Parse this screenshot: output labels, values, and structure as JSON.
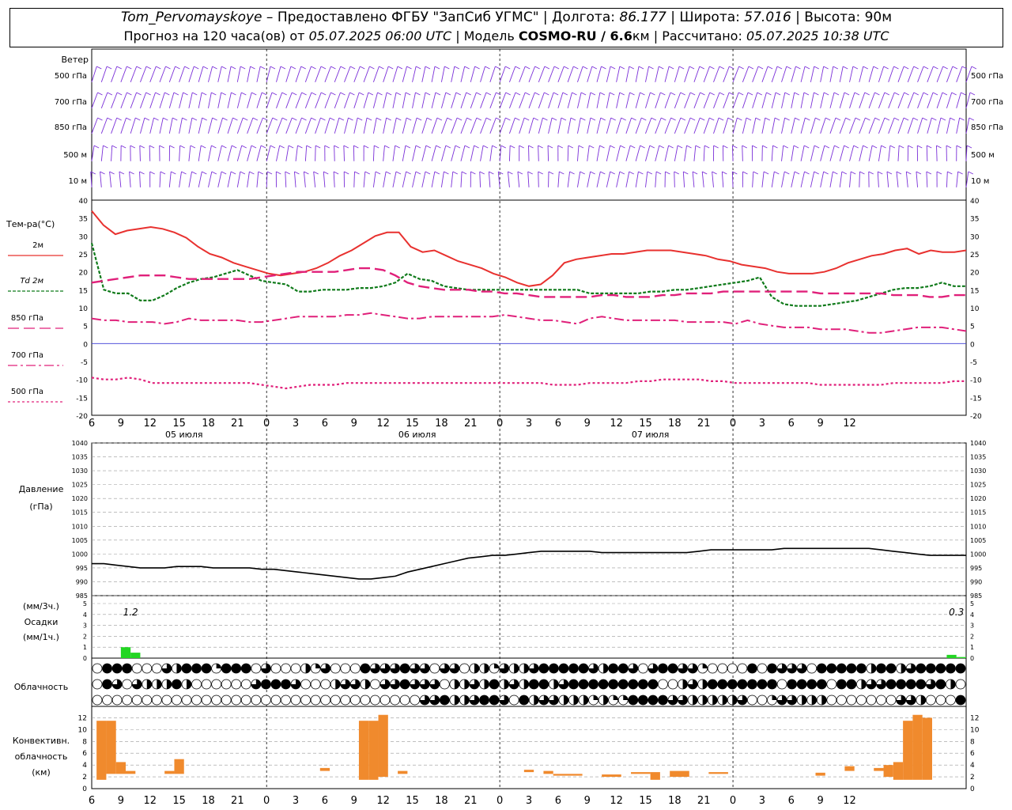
{
  "header": {
    "station": "Tom_Pervomayskoye",
    "provider": " – Предоставлено ФГБУ \"ЗапСиб УГМС\" | Долгота: ",
    "lon": "86.177",
    "lat_label": " | Широта: ",
    "lat": "57.016",
    "alt_label": " | Высота: ",
    "alt": "90м",
    "forecast_label": "Прогноз на 120 часа(ов) от ",
    "run_time": "05.07.2025 06:00 UTC",
    "model_label": " | Модель ",
    "model": "COSMO-RU / 6.6",
    "model_unit": "км | Рассчитано: ",
    "calc_time": "05.07.2025 10:38 UTC"
  },
  "labels": {
    "wind": "Ветер",
    "levels": [
      "500 гПа",
      "700 гПа",
      "850 гПа",
      "500 м",
      "10 м"
    ],
    "temp": "Тем-ра(°С)",
    "legend": [
      "2м",
      "Td 2м",
      "850 гПа",
      "700 гПа",
      "500 гПа"
    ],
    "pressure": [
      "Давление",
      "(гПа)"
    ],
    "precip": [
      "(мм/3ч.)",
      "Осадки",
      "(мм/1ч.)"
    ],
    "cloud": "Облачность",
    "conv": [
      "Конвективн.",
      "облачность",
      "(км)"
    ],
    "days": [
      "05 июля",
      "06 июля",
      "07 июля"
    ],
    "precip_vals": [
      "1.2",
      "0.3"
    ]
  },
  "colors": {
    "t2m": "#e8312f",
    "td": "#0f7a1a",
    "t850": "#e0207a",
    "t700": "#e0207a",
    "t500": "#e0207a",
    "wind": "#7a2fd8",
    "zero": "#3b3bd6",
    "pres": "#000000",
    "precip": "#22d622",
    "conv": "#f08a2d"
  },
  "chart_data": [
    {
      "type": "line",
      "title": "Тем-ра(°С)",
      "x_hours": [
        6,
        7,
        8,
        9,
        10,
        11,
        12,
        13,
        14,
        15,
        16,
        17,
        18,
        19,
        20,
        21,
        22,
        23,
        24,
        25,
        26,
        27,
        28,
        29,
        30,
        31,
        32,
        33,
        34,
        35,
        36,
        37,
        38,
        39,
        40,
        41,
        42,
        43,
        44,
        45,
        46,
        47,
        48,
        49,
        50,
        51,
        52,
        53,
        54,
        55,
        56,
        57,
        58,
        59,
        60,
        61,
        62,
        63,
        64,
        65,
        66,
        67,
        68,
        69,
        70,
        71,
        72,
        73,
        74,
        75,
        76,
        77,
        78,
        79,
        80,
        81,
        82,
        83,
        84,
        85,
        86,
        87,
        88,
        89,
        90,
        91,
        92,
        93,
        94,
        95,
        96
      ],
      "ylim": [
        -20,
        40
      ],
      "xtick_labels": [
        "6",
        "9",
        "12",
        "15",
        "18",
        "21",
        "0",
        "3",
        "6",
        "9",
        "12",
        "15",
        "18",
        "21",
        "0",
        "3",
        "6",
        "9",
        "12",
        "15",
        "18",
        "21",
        "0",
        "3",
        "6",
        "9",
        "12"
      ],
      "series": [
        {
          "name": "2м",
          "values": [
            37,
            33,
            30.5,
            31.5,
            32,
            32.5,
            32,
            31,
            29.5,
            27,
            25,
            24,
            22.5,
            21.5,
            20.5,
            19.5,
            19,
            19.5,
            20,
            21,
            22.5,
            24.5,
            26,
            28,
            30,
            31,
            31,
            27,
            25.5,
            26,
            24.5,
            23,
            22,
            21,
            19.5,
            18.5,
            17,
            16,
            16.5,
            19,
            22.5,
            23.5,
            24,
            24.5,
            25,
            25,
            25.5,
            26,
            26,
            26,
            25.5,
            25,
            24.5,
            23.5,
            23,
            22,
            21.5,
            21,
            20,
            19.5,
            19.5,
            19.5,
            20,
            21,
            22.5,
            23.5,
            24.5,
            25,
            26,
            26.5,
            25,
            26,
            25.5,
            25.5,
            26
          ]
        },
        {
          "name": "Td 2м",
          "values": [
            28,
            15,
            14,
            14,
            12,
            12,
            13.5,
            15.5,
            17,
            18,
            18.5,
            19.5,
            20.5,
            19,
            17.5,
            17,
            16.5,
            14.5,
            14.5,
            15,
            15,
            15,
            15.5,
            15.5,
            16,
            17,
            19.5,
            18,
            17.5,
            16,
            15.5,
            15,
            15,
            15,
            15,
            15,
            15,
            15,
            15,
            15,
            15,
            14,
            14,
            14,
            14,
            14,
            14.5,
            14.5,
            15,
            15,
            15.5,
            16,
            16.5,
            17,
            17.5,
            18.5,
            13,
            11,
            10.5,
            10.5,
            10.5,
            11,
            11.5,
            12,
            13,
            14,
            15,
            15.5,
            15.5,
            16,
            17,
            16,
            16
          ]
        },
        {
          "name": "850 гПа",
          "values": [
            17,
            17.5,
            18,
            18.5,
            19,
            19,
            19,
            18.5,
            18,
            18,
            18,
            18,
            18,
            18,
            18.5,
            19,
            19.5,
            20,
            20,
            20,
            20,
            20.5,
            21,
            21,
            20.5,
            19,
            17,
            16,
            15.5,
            15,
            15,
            15,
            14.5,
            14.5,
            14,
            14,
            13.5,
            13,
            13,
            13,
            13,
            13,
            13.5,
            13.5,
            13,
            13,
            13,
            13.5,
            13.5,
            14,
            14,
            14,
            14.5,
            14.5,
            14.5,
            14.5,
            14.5,
            14.5,
            14.5,
            14.5,
            14,
            14,
            14,
            14,
            14,
            14,
            13.5,
            13.5,
            13.5,
            13,
            13,
            13.5,
            13.5
          ]
        },
        {
          "name": "700 гПа",
          "values": [
            7,
            6.5,
            6.5,
            6,
            6,
            6,
            5.5,
            6,
            7,
            6.5,
            6.5,
            6.5,
            6.5,
            6,
            6,
            6.5,
            7,
            7.5,
            7.5,
            7.5,
            7.5,
            8,
            8,
            8.5,
            8,
            7.5,
            7,
            7,
            7.5,
            7.5,
            7.5,
            7.5,
            7.5,
            7.5,
            8,
            7.5,
            7,
            6.5,
            6.5,
            6,
            5.5,
            7,
            7.5,
            7,
            6.5,
            6.5,
            6.5,
            6.5,
            6.5,
            6,
            6,
            6,
            6,
            5.5,
            6.5,
            5.5,
            5,
            4.5,
            4.5,
            4.5,
            4,
            4,
            4,
            3.5,
            3,
            3,
            3.5,
            4,
            4.5,
            4.5,
            4.5,
            4,
            3.5
          ]
        },
        {
          "name": "500 гПа",
          "values": [
            -9.5,
            -10,
            -10,
            -9.5,
            -10,
            -11,
            -11,
            -11,
            -11,
            -11,
            -11,
            -11,
            -11,
            -11,
            -11.5,
            -12,
            -12.5,
            -12,
            -11.5,
            -11.5,
            -11.5,
            -11,
            -11,
            -11,
            -11,
            -11,
            -11,
            -11,
            -11,
            -11,
            -11,
            -11,
            -11,
            -11,
            -11,
            -11,
            -11,
            -11,
            -11.5,
            -11.5,
            -11.5,
            -11,
            -11,
            -11,
            -11,
            -10.5,
            -10.5,
            -10,
            -10,
            -10,
            -10,
            -10.5,
            -10.5,
            -11,
            -11,
            -11,
            -11,
            -11,
            -11,
            -11,
            -11.5,
            -11.5,
            -11.5,
            -11.5,
            -11.5,
            -11.5,
            -11,
            -11,
            -11,
            -11,
            -11,
            -10.5,
            -10.5
          ]
        }
      ]
    },
    {
      "type": "line",
      "title": "Давление (гПа)",
      "ylim": [
        985,
        1040
      ],
      "series": [
        {
          "name": "Давление",
          "values": [
            996.5,
            996.5,
            996,
            995.5,
            995,
            995,
            995,
            995.5,
            995.5,
            995.5,
            995,
            995,
            995,
            995,
            994.5,
            994.5,
            994,
            993.5,
            993,
            992.5,
            992,
            991.5,
            991,
            991,
            991.5,
            992,
            993.5,
            994.5,
            995.5,
            996.5,
            997.5,
            998.5,
            999,
            999.5,
            999.5,
            1000,
            1000.5,
            1001,
            1001,
            1001,
            1001,
            1001,
            1000.5,
            1000.5,
            1000.5,
            1000.5,
            1000.5,
            1000.5,
            1000.5,
            1000.5,
            1001,
            1001.5,
            1001.5,
            1001.5,
            1001.5,
            1001.5,
            1001.5,
            1002,
            1002,
            1002,
            1002,
            1002,
            1002,
            1002,
            1002,
            1001.5,
            1001,
            1000.5,
            1000,
            999.5,
            999.5,
            999.5,
            999.5
          ]
        }
      ]
    },
    {
      "type": "bar",
      "title": "Осадки (мм/3ч.) (мм/1ч.)",
      "ylim": [
        0,
        5
      ],
      "bars": [
        {
          "hour": 9.5,
          "value": 1.0
        },
        {
          "hour": 10.5,
          "value": 0.5
        },
        {
          "hour": 94.5,
          "value": 0.3
        },
        {
          "hour": 95.5,
          "value": 0.1
        }
      ],
      "annotations": [
        {
          "hour": 10,
          "text": "1.2"
        },
        {
          "hour": 95,
          "text": "0.3"
        }
      ]
    },
    {
      "type": "bar",
      "title": "Конвективн. облачность (км)",
      "ylim": [
        0,
        13
      ],
      "bars": [
        {
          "from": 6.5,
          "to": 7.5,
          "bottom": 1.5,
          "top": 11.5
        },
        {
          "from": 7.5,
          "to": 8.5,
          "bottom": 2.5,
          "top": 11.5
        },
        {
          "from": 8.5,
          "to": 9.5,
          "bottom": 2.5,
          "top": 4.5
        },
        {
          "from": 9.5,
          "to": 10.5,
          "bottom": 2.5,
          "top": 3.0
        },
        {
          "from": 13.5,
          "to": 14.5,
          "bottom": 2.5,
          "top": 3.0
        },
        {
          "from": 14.5,
          "to": 15.5,
          "bottom": 2.5,
          "top": 5.0
        },
        {
          "from": 29.5,
          "to": 30.5,
          "bottom": 3.0,
          "top": 3.5
        },
        {
          "from": 33.5,
          "to": 34.5,
          "bottom": 1.5,
          "top": 11.5
        },
        {
          "from": 34.5,
          "to": 35.5,
          "bottom": 1.5,
          "top": 11.5
        },
        {
          "from": 35.5,
          "to": 36.5,
          "bottom": 2.0,
          "top": 12.5
        },
        {
          "from": 37.5,
          "to": 38.5,
          "bottom": 2.5,
          "top": 3.0
        },
        {
          "from": 50.5,
          "to": 51.5,
          "bottom": 2.8,
          "top": 3.2
        },
        {
          "from": 52.5,
          "to": 53.5,
          "bottom": 2.5,
          "top": 3.0
        },
        {
          "from": 53.5,
          "to": 56.5,
          "bottom": 2.2,
          "top": 2.5
        },
        {
          "from": 58.5,
          "to": 60.5,
          "bottom": 2.0,
          "top": 2.4
        },
        {
          "from": 61.5,
          "to": 63.5,
          "bottom": 2.5,
          "top": 2.8
        },
        {
          "from": 63.5,
          "to": 64.5,
          "bottom": 1.5,
          "top": 2.8
        },
        {
          "from": 65.5,
          "to": 67.5,
          "bottom": 2.0,
          "top": 3.0
        },
        {
          "from": 69.5,
          "to": 71.5,
          "bottom": 2.5,
          "top": 2.8
        },
        {
          "from": 80.5,
          "to": 81.5,
          "bottom": 2.2,
          "top": 2.7
        },
        {
          "from": 83.5,
          "to": 84.5,
          "bottom": 3.0,
          "top": 3.8
        },
        {
          "from": 86.5,
          "to": 87.5,
          "bottom": 3.0,
          "top": 3.5
        },
        {
          "from": 87.5,
          "to": 88.5,
          "bottom": 2.0,
          "top": 4.0
        },
        {
          "from": 88.5,
          "to": 89.5,
          "bottom": 1.5,
          "top": 4.5
        },
        {
          "from": 89.5,
          "to": 90.5,
          "bottom": 1.5,
          "top": 11.5
        },
        {
          "from": 90.5,
          "to": 91.5,
          "bottom": 1.5,
          "top": 12.5
        },
        {
          "from": 91.5,
          "to": 92.5,
          "bottom": 1.5,
          "top": 12.0
        }
      ]
    }
  ],
  "cloud_rows": [
    "0444000324441444030002130004333433033022132234444432443034433100004043330444442442344444",
    "0430322242000000344430002332033433302232423244234444444440023244444440444404423344443420",
    "0000000000000000000000000000000003342234430423322212114444332222230013322200000003320004"
  ]
}
